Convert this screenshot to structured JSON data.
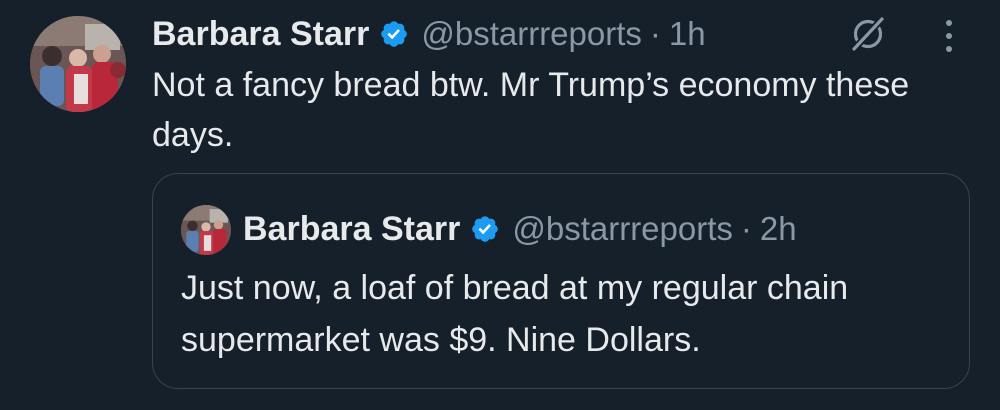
{
  "tweet": {
    "author_name": "Barbara Starr",
    "handle": "@bstarrreports",
    "separator": "·",
    "time": "1h",
    "text": "Not a fancy bread btw. Mr Trump’s economy these days."
  },
  "quoted_tweet": {
    "author_name": "Barbara Starr",
    "handle": "@bstarrreports",
    "separator": "·",
    "time": "2h",
    "text": "Just now, a loaf of bread at my regular chain supermarket was $9. Nine Dollars."
  },
  "icons": {
    "verified": "verified-badge-icon",
    "grok": "grok-icon",
    "more": "more-options-icon"
  },
  "colors": {
    "background": "#15202b",
    "primary_text": "#e7e9ea",
    "secondary_text": "#8b98a5",
    "verified_blue": "#1d9bf0",
    "border": "#38444d"
  }
}
